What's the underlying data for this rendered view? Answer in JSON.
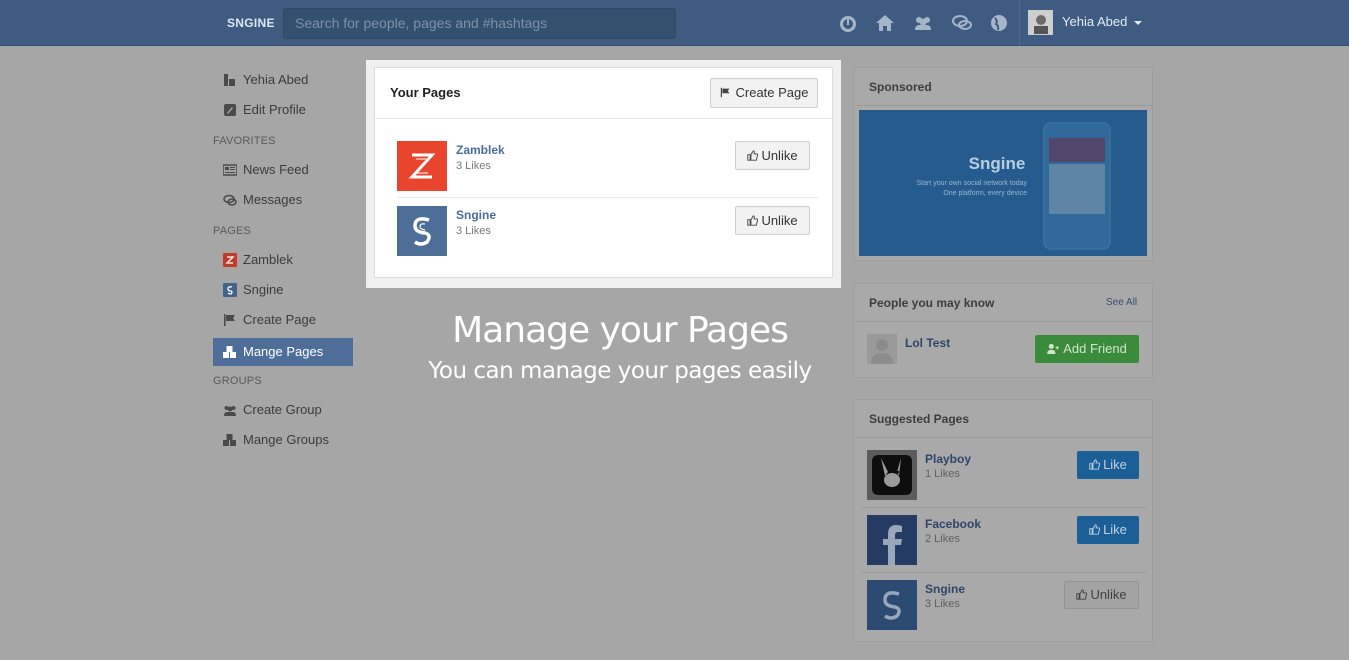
{
  "topbar": {
    "brand": "SNGINE",
    "search_placeholder": "Search for people, pages and #hashtags",
    "icons": [
      "dashboard-icon",
      "home-icon",
      "friends-icon",
      "messages-icon",
      "globe-icon"
    ],
    "user_name": "Yehia Abed"
  },
  "sidebar": {
    "profile_name": "Yehia Abed",
    "edit_profile": "Edit Profile",
    "favorites_header": "FAVORITES",
    "news_feed": "News Feed",
    "messages": "Messages",
    "pages_header": "PAGES",
    "page_zamblek": "Zamblek",
    "page_sngine": "Sngine",
    "create_page": "Create Page",
    "manage_pages": "Mange Pages",
    "groups_header": "GROUPS",
    "create_group": "Create Group",
    "manage_groups": "Mange Groups"
  },
  "your_pages": {
    "title": "Your Pages",
    "create_button": "Create Page",
    "pages": [
      {
        "name": "Zamblek",
        "likes": "3 Likes",
        "button": "Unlike",
        "color": "#e8442e"
      },
      {
        "name": "Sngine",
        "likes": "3 Likes",
        "button": "Unlike",
        "color": "#4d6e97"
      }
    ]
  },
  "caption": {
    "title": "Manage your Pages",
    "subtitle": "You can manage your pages easily"
  },
  "sponsored": {
    "title": "Sponsored",
    "ad_title": "Sngine",
    "ad_line1": "Start your own social network today",
    "ad_line2": "One platform, every device"
  },
  "people": {
    "title": "People you may know",
    "see_all": "See All",
    "person_name": "Lol Test",
    "add_button": "Add Friend"
  },
  "suggested": {
    "title": "Suggested Pages",
    "pages": [
      {
        "name": "Playboy",
        "likes": "1 Likes",
        "button": "Like"
      },
      {
        "name": "Facebook",
        "likes": "2 Likes",
        "button": "Like"
      },
      {
        "name": "Sngine",
        "likes": "3 Likes",
        "button": "Unlike"
      }
    ]
  },
  "colors": {
    "topbar": "#3f5b82",
    "accent": "#4e6d99",
    "zamblek": "#e8442e",
    "like_button": "#1c5f97",
    "add_friend": "#3a8c3a"
  }
}
